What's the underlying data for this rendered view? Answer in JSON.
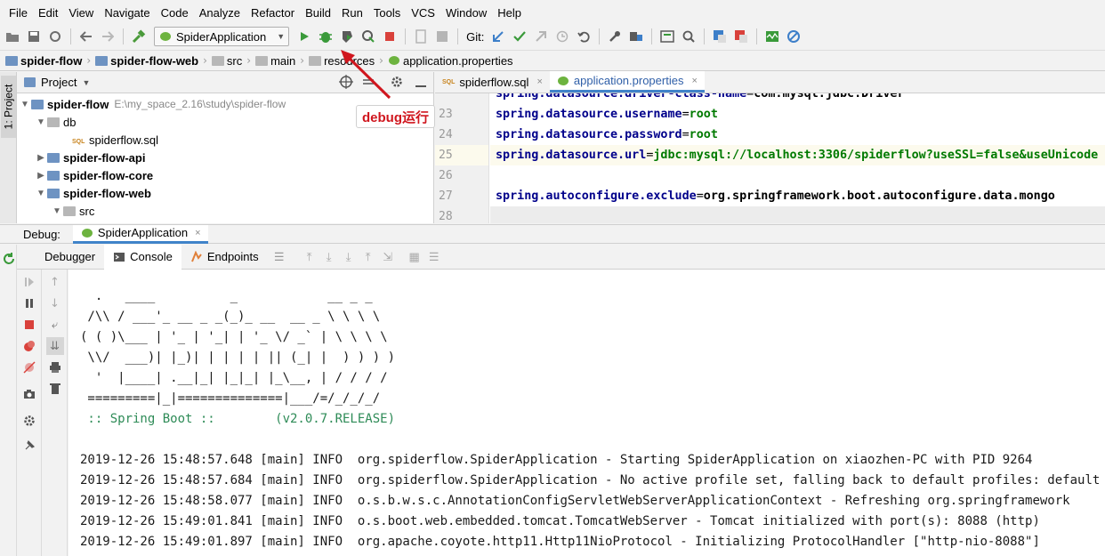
{
  "menu": [
    "File",
    "Edit",
    "View",
    "Navigate",
    "Code",
    "Analyze",
    "Refactor",
    "Build",
    "Run",
    "Tools",
    "VCS",
    "Window",
    "Help"
  ],
  "toolbar": {
    "run_config": "SpiderApplication",
    "git_label": "Git:"
  },
  "breadcrumb": [
    "spider-flow",
    "spider-flow-web",
    "src",
    "main",
    "resources",
    "application.properties"
  ],
  "project": {
    "title": "Project",
    "root": {
      "name": "spider-flow",
      "path": "E:\\my_space_2.16\\study\\spider-flow"
    },
    "items": [
      {
        "label": "db"
      },
      {
        "label": "spiderflow.sql"
      },
      {
        "label": "spider-flow-api"
      },
      {
        "label": "spider-flow-core"
      },
      {
        "label": "spider-flow-web"
      },
      {
        "label": "src"
      }
    ],
    "strip_label": "1: Project"
  },
  "editor": {
    "tabs": [
      "spiderflow.sql",
      "application.properties"
    ],
    "line_numbers": [
      "",
      "23",
      "24",
      "25",
      "26",
      "27",
      "28"
    ],
    "lines": [
      {
        "key": "spring.datasource.driver-class-name",
        "value": "com.mysql.jdbc.Driver"
      },
      {
        "key": "spring.datasource.username",
        "value": "root"
      },
      {
        "key": "spring.datasource.password",
        "value": "root"
      },
      {
        "key": "spring.datasource.url",
        "value": "jdbc:mysql://localhost:3306/spiderflow?useSSL=false&useUnicode"
      },
      {
        "key": "",
        "value": ""
      },
      {
        "key": "spring.autoconfigure.exclude",
        "value": "org.springframework.boot.autoconfigure.data.mongo"
      }
    ]
  },
  "debug": {
    "label": "Debug:",
    "session": "SpiderApplication",
    "tabs": [
      "Debugger",
      "Console",
      "Endpoints"
    ]
  },
  "console": {
    "banner": [
      "  .   ____          _            __ _ _",
      " /\\\\ / ___'_ __ _ _(_)_ __  __ _ \\ \\ \\ \\",
      "( ( )\\___ | '_ | '_| | '_ \\/ _` | \\ \\ \\ \\",
      " \\\\/  ___)| |_)| | | | | || (_| |  ) ) ) )",
      "  '  |____| .__|_| |_|_| |_\\__, | / / / /",
      " =========|_|==============|___/=/_/_/_/"
    ],
    "spring_boot": " :: Spring Boot ::        (v2.0.7.RELEASE)",
    "logs": [
      "2019-12-26 15:48:57.648 [main] INFO  org.spiderflow.SpiderApplication - Starting SpiderApplication on xiaozhen-PC with PID 9264",
      "2019-12-26 15:48:57.684 [main] INFO  org.spiderflow.SpiderApplication - No active profile set, falling back to default profiles: default",
      "2019-12-26 15:48:58.077 [main] INFO  o.s.b.w.s.c.AnnotationConfigServletWebServerApplicationContext - Refreshing org.springframework",
      "2019-12-26 15:49:01.841 [main] INFO  o.s.boot.web.embedded.tomcat.TomcatWebServer - Tomcat initialized with port(s): 8088 (http)",
      "2019-12-26 15:49:01.897 [main] INFO  org.apache.coyote.http11.Http11NioProtocol - Initializing ProtocolHandler [\"http-nio-8088\"]"
    ]
  },
  "annotation": {
    "text": "debug运行",
    "color": "#d0161e"
  },
  "colors": {
    "accent": "#4083c9",
    "run_green": "#3a9a3a",
    "stop_red": "#d9413b"
  }
}
